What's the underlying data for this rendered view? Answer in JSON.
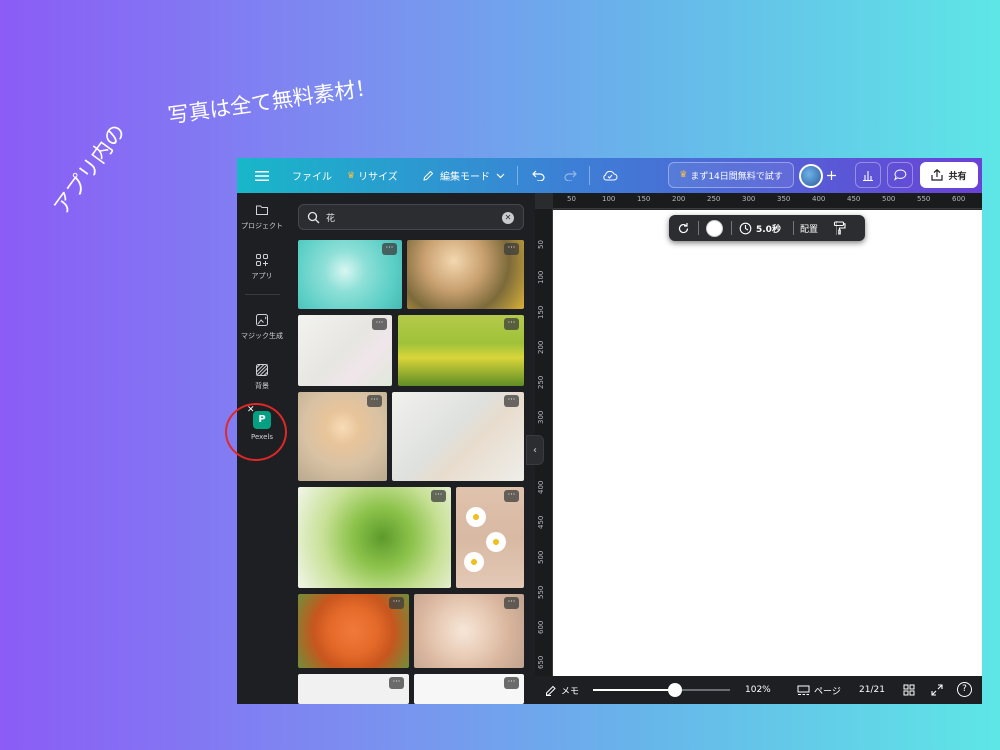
{
  "caption": {
    "part1": "アプリ内の",
    "part2": "写真は全て無料素材！"
  },
  "topbar": {
    "menu_label": "",
    "file_label": "ファイル",
    "resize_label": "リサイズ",
    "edit_mode_label": "編集モード",
    "trial_label": "まず14日間無料で試す",
    "share_label": "共有"
  },
  "sidebar": {
    "items": [
      {
        "label": "プロジェクト",
        "icon": "folder-icon"
      },
      {
        "label": "アプリ",
        "icon": "apps-icon"
      },
      {
        "label": "マジック生成",
        "icon": "magic-image-icon"
      },
      {
        "label": "背景",
        "icon": "background-icon"
      },
      {
        "label": "Pexels",
        "icon": "pexels-icon"
      }
    ]
  },
  "search": {
    "value": "花"
  },
  "ruler": {
    "x_ticks": [
      "50",
      "100",
      "150",
      "200",
      "250",
      "300",
      "350",
      "400",
      "450",
      "500",
      "550",
      "600"
    ],
    "y_ticks": [
      "50",
      "100",
      "150",
      "200",
      "250",
      "300",
      "350",
      "400",
      "450",
      "500",
      "550",
      "600",
      "650"
    ]
  },
  "floatbar": {
    "duration_label": "5.0秒",
    "position_label": "配置"
  },
  "bottombar": {
    "notes_label": "メモ",
    "zoom_label": "102%",
    "zoom_level": 0.6,
    "pages_label": "ページ",
    "page_count": "21/21",
    "help_label": "?"
  },
  "colors": {
    "accent_ring": "#e02828",
    "pexels_green": "#05a081"
  }
}
